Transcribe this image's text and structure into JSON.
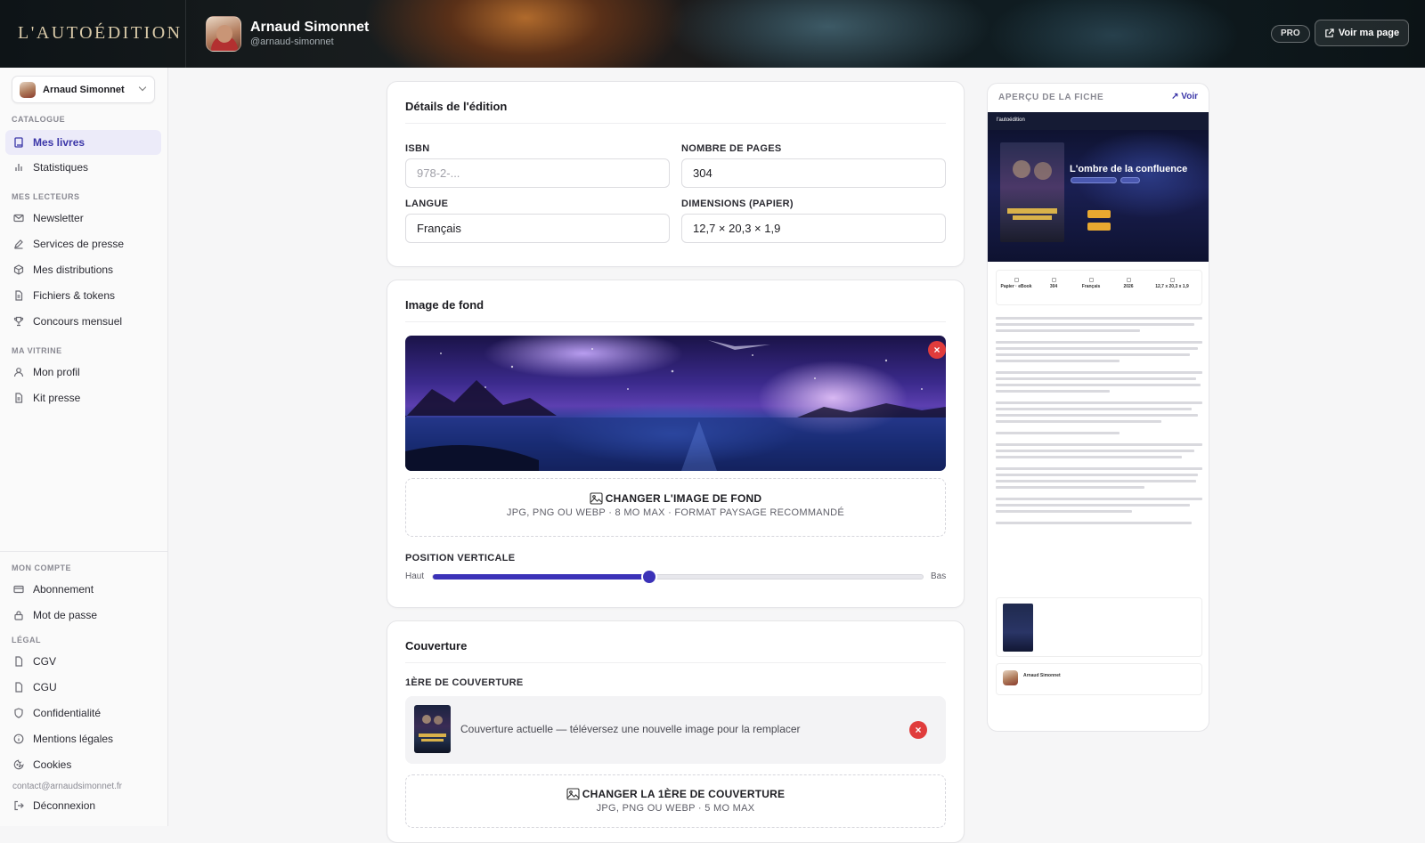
{
  "header": {
    "logo": "L'AUTOÉDITION",
    "user_name": "Arnaud Simonnet",
    "user_handle": "@arnaud-simonnet",
    "badge": "PRO",
    "view_page_button": "Voir ma page"
  },
  "sidebar": {
    "account_name": "Arnaud Simonnet",
    "sections": {
      "catalogue": "CATALOGUE",
      "readers": "MES LECTEURS",
      "showcase": "MA VITRINE",
      "account": "MON COMPTE",
      "legal": "LÉGAL"
    },
    "items": {
      "books": "Mes livres",
      "stats": "Statistiques",
      "newsletter": "Newsletter",
      "press": "Services de presse",
      "distributions": "Mes distributions",
      "files": "Fichiers & tokens",
      "contest": "Concours mensuel",
      "profile": "Mon profil",
      "presskit": "Kit presse",
      "subscription": "Abonnement",
      "password": "Mot de passe",
      "cgv": "CGV",
      "cgu": "CGU",
      "privacy": "Confidentialité",
      "legal_notice": "Mentions légales",
      "cookies": "Cookies"
    },
    "email": "contact@arnaudsimonnet.fr",
    "logout": "Déconnexion"
  },
  "edition": {
    "title": "Détails de l'édition",
    "isbn_label": "ISBN",
    "isbn_placeholder": "978-2-...",
    "pages_label": "NOMBRE DE PAGES",
    "pages_value": "304",
    "language_label": "LANGUE",
    "language_value": "Français",
    "dimensions_label": "DIMENSIONS (PAPIER)",
    "dimensions_value": "12,7 × 20,3 × 1,9"
  },
  "background": {
    "title": "Image de fond",
    "change_label": "CHANGER L'IMAGE DE FOND",
    "change_hint": "JPG, PNG OU WEBP · 8 MO MAX · FORMAT PAYSAGE RECOMMANDÉ",
    "position_label": "POSITION VERTICALE",
    "top_label": "Haut",
    "bottom_label": "Bas",
    "position_fraction": 0.44
  },
  "cover": {
    "title": "Couverture",
    "front_label": "1ÈRE DE COUVERTURE",
    "current_text": "Couverture actuelle — téléversez une nouvelle image pour la remplacer",
    "change_label": "CHANGER LA 1ÈRE DE COUVERTURE",
    "change_hint": "JPG, PNG OU WEBP · 5 MO MAX"
  },
  "preview": {
    "title": "APERÇU DE LA FICHE",
    "view_link": "Voir",
    "site_name": "l'autoédition",
    "book_title": "L'ombre de la confluence",
    "stats": [
      "Papier · eBook",
      "304",
      "Français",
      "2026",
      "12,7 x 20,3 x 1,9"
    ],
    "author": "Arnaud Simonnet"
  },
  "colors": {
    "accent": "#3b36a8",
    "slider": "#3b32b8",
    "danger": "#e03c3c"
  }
}
